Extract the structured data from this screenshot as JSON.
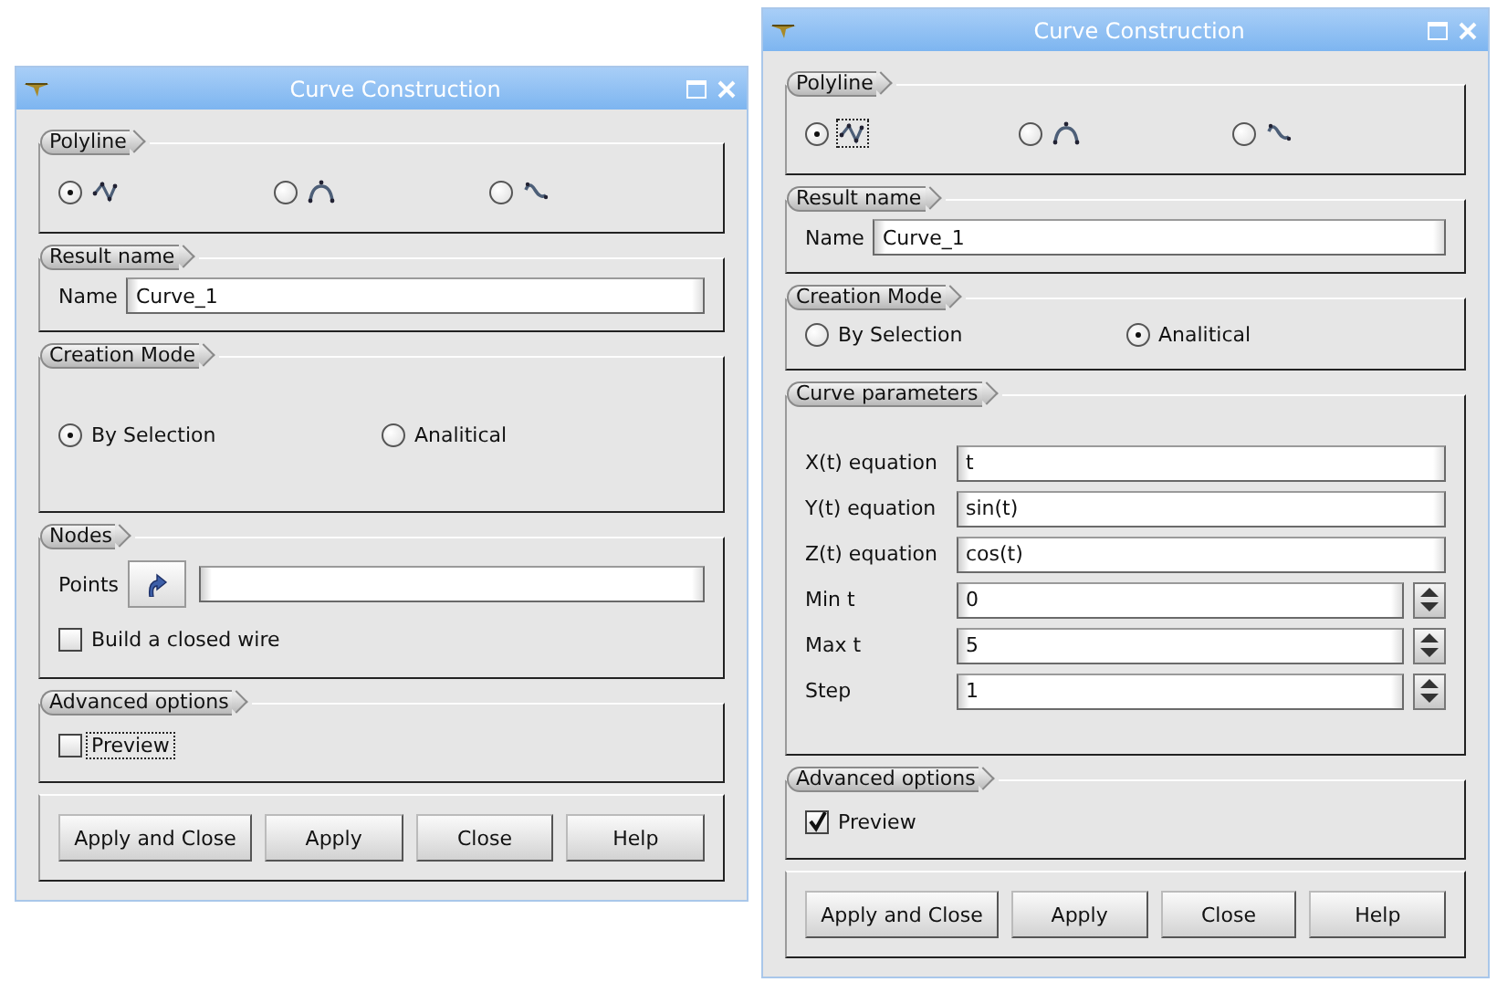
{
  "windows": [
    {
      "title": "Curve Construction",
      "groups": [
        {
          "kind": "icon_radios",
          "label": "Polyline",
          "options": [
            {
              "selected": true,
              "focused": false
            },
            {
              "selected": false,
              "focused": false
            },
            {
              "selected": false,
              "focused": false
            }
          ]
        },
        {
          "kind": "name",
          "label": "Result name",
          "field_label": "Name",
          "value": "Curve_1"
        },
        {
          "kind": "radios",
          "label": "Creation Mode",
          "options": [
            {
              "label": "By Selection",
              "selected": true
            },
            {
              "label": "Analitical",
              "selected": false
            }
          ]
        },
        {
          "kind": "nodes",
          "label": "Nodes",
          "field_label": "Points",
          "checkbox": {
            "label": "Build a closed wire",
            "checked": false,
            "focused": false
          }
        },
        {
          "kind": "options",
          "label": "Advanced options",
          "checkbox": {
            "label": "Preview",
            "checked": false,
            "focused": true
          }
        }
      ],
      "buttons": [
        "Apply and Close",
        "Apply",
        "Close",
        "Help"
      ]
    },
    {
      "title": "Curve Construction",
      "groups": [
        {
          "kind": "icon_radios",
          "label": "Polyline",
          "options": [
            {
              "selected": true,
              "focused": true
            },
            {
              "selected": false,
              "focused": false
            },
            {
              "selected": false,
              "focused": false
            }
          ]
        },
        {
          "kind": "name",
          "label": "Result name",
          "field_label": "Name",
          "value": "Curve_1"
        },
        {
          "kind": "radios",
          "label": "Creation Mode",
          "options": [
            {
              "label": "By Selection",
              "selected": false
            },
            {
              "label": "Analitical",
              "selected": true
            }
          ]
        },
        {
          "kind": "parameters",
          "label": "Curve parameters",
          "rows": [
            {
              "kind": "text",
              "label": "X(t) equation",
              "value": "t"
            },
            {
              "kind": "text",
              "label": "Y(t) equation",
              "value": "sin(t)"
            },
            {
              "kind": "text",
              "label": "Z(t) equation",
              "value": "cos(t)"
            },
            {
              "kind": "spin",
              "label": "Min t",
              "value": "0"
            },
            {
              "kind": "spin",
              "label": "Max t",
              "value": "5"
            },
            {
              "kind": "spin",
              "label": "Step",
              "value": "1"
            }
          ]
        },
        {
          "kind": "options",
          "label": "Advanced options",
          "checkbox": {
            "label": "Preview",
            "checked": true,
            "focused": false
          }
        }
      ],
      "buttons": [
        "Apply and Close",
        "Apply",
        "Close",
        "Help"
      ]
    }
  ]
}
